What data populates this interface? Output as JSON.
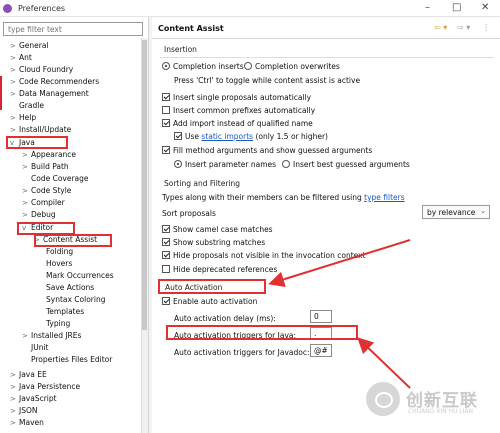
{
  "window": {
    "title": "Preferences",
    "minimize": "–",
    "maximize": "□",
    "close": "✕"
  },
  "filter": {
    "placeholder": "type filter text"
  },
  "tree": {
    "general": "General",
    "ant": "Ant",
    "cloud_foundry": "Cloud Foundry",
    "code_recommenders": "Code Recommenders",
    "data_management": "Data Management",
    "gradle": "Gradle",
    "help": "Help",
    "install_update": "Install/Update",
    "java": "Java",
    "appearance": "Appearance",
    "build_path": "Build Path",
    "code_coverage": "Code Coverage",
    "code_style": "Code Style",
    "compiler": "Compiler",
    "debug": "Debug",
    "editor": "Editor",
    "content_assist": "Content Assist",
    "folding": "Folding",
    "hovers": "Hovers",
    "mark_occurrences": "Mark Occurrences",
    "save_actions": "Save Actions",
    "syntax_coloring": "Syntax Coloring",
    "templates": "Templates",
    "typing": "Typing",
    "installed_jres": "Installed JREs",
    "junit": "JUnit",
    "properties_files_editor": "Properties Files Editor",
    "java_ee": "Java EE",
    "java_persistence": "Java Persistence",
    "javascript": "JavaScript",
    "json": "JSON",
    "maven": "Maven"
  },
  "page": {
    "title": "Content Assist",
    "insertion": {
      "header": "Insertion",
      "completion_inserts": "Completion inserts",
      "completion_overwrites": "Completion overwrites",
      "toggle_hint": "Press 'Ctrl' to toggle while content assist is active",
      "insert_single": "Insert single proposals automatically",
      "insert_common_prefixes": "Insert common prefixes automatically",
      "add_import": "Add import instead of qualified name",
      "use_prefix": "Use",
      "static_imports_link": "static imports",
      "use_suffix": "(only 1.5 or higher)",
      "fill_method_args": "Fill method arguments and show guessed arguments",
      "insert_param_names": "Insert parameter names",
      "insert_best_guessed": "Insert best guessed arguments"
    },
    "sorting": {
      "header": "Sorting and Filtering",
      "filter_prefix": "Types along with their members can be filtered using",
      "type_filters_link": "type filters",
      "sort_proposals": "Sort proposals",
      "sort_value": "by relevance",
      "show_camel": "Show camel case matches",
      "show_substring": "Show substring matches",
      "hide_not_visible": "Hide proposals not visible in the invocation context",
      "hide_deprecated": "Hide deprecated references"
    },
    "auto": {
      "header": "Auto Activation",
      "enable": "Enable auto activation",
      "delay_label": "Auto activation delay (ms):",
      "delay_value": "0",
      "java_label": "Auto activation triggers for Java:",
      "java_value": ".",
      "javadoc_label": "Auto activation triggers for Javadoc:",
      "javadoc_value": "@#"
    }
  },
  "watermark": {
    "brand": "创新互联",
    "tagline": "CHUANG XIN HU LIAN"
  },
  "colors": {
    "annotation_red": "#e03131",
    "link_blue": "#1b57c6"
  }
}
